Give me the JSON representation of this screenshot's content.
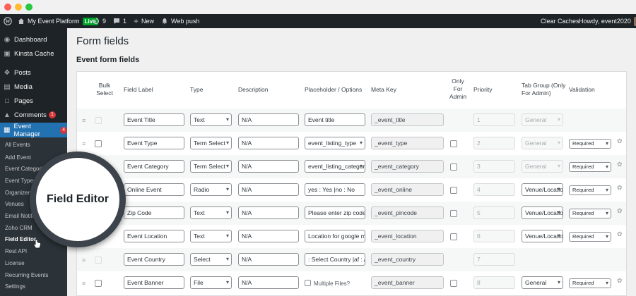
{
  "admin_bar": {
    "site_name": "My Event Platform",
    "live_badge": "Live",
    "updates_count": "9",
    "comments_count": "1",
    "new_label": "New",
    "web_push_label": "Web push",
    "clear_caches_label": "Clear Caches",
    "howdy_label": "Howdy, event2020"
  },
  "sidebar": {
    "items": [
      {
        "label": "Dashboard",
        "icon": "dashboard-icon"
      },
      {
        "label": "Kinsta Cache",
        "icon": "kinsta-icon"
      },
      {
        "label": "Posts",
        "icon": "pin-icon"
      },
      {
        "label": "Media",
        "icon": "media-icon"
      },
      {
        "label": "Pages",
        "icon": "pages-icon"
      },
      {
        "label": "Comments",
        "icon": "comments-icon",
        "badge": "1"
      },
      {
        "label": "Event Manager",
        "icon": "calendar-icon",
        "badge": "4",
        "active": true
      }
    ],
    "submenu": [
      "All Events",
      "Add Event",
      "Event Categories",
      "Event Types",
      "Organizers",
      "Venues",
      "Email Notifications",
      "Zoho CRM",
      "Field Editor",
      "Rest API",
      "License",
      "Recurring Events",
      "Settings"
    ],
    "current_submenu": "Field Editor"
  },
  "magnifier_label": "Field Editor",
  "page_title": "Form fields",
  "section_title": "Event form fields",
  "columns": {
    "bulk_select": "Bulk Select",
    "field_label": "Field Label",
    "type": "Type",
    "description": "Description",
    "placeholder": "Placeholder / Options",
    "meta_key": "Meta Key",
    "only_for_admin": "Only For Admin",
    "priority": "Priority",
    "tab_group": "Tab Group (Only For Admin)",
    "validation": "Validation"
  },
  "rows": [
    {
      "label": "Event Title",
      "type": "Text",
      "description": "N/A",
      "placeholder": "Event title",
      "placeholder_kind": "input",
      "meta_key": "_event_title",
      "priority": "1",
      "tab_group": "General",
      "tab_disabled": true,
      "validation": "",
      "bulk_enabled": false,
      "admin_checkbox": false,
      "gear": false
    },
    {
      "label": "Event Type",
      "type": "Term Select",
      "description": "N/A",
      "placeholder": "event_listing_type",
      "placeholder_kind": "select",
      "meta_key": "_event_type",
      "priority": "2",
      "tab_group": "General",
      "tab_disabled": true,
      "validation": "Required",
      "bulk_enabled": true,
      "admin_checkbox": true,
      "gear": true
    },
    {
      "label": "Event Category",
      "type": "Term Select",
      "description": "N/A",
      "placeholder": "event_listing_category",
      "placeholder_kind": "select",
      "meta_key": "_event_category",
      "priority": "3",
      "tab_group": "General",
      "tab_disabled": true,
      "validation": "Required",
      "bulk_enabled": true,
      "admin_checkbox": true,
      "gear": true
    },
    {
      "label": "Online Event",
      "type": "Radio",
      "description": "N/A",
      "placeholder": "yes : Yes |no : No",
      "placeholder_kind": "input",
      "meta_key": "_event_online",
      "priority": "4",
      "tab_group": "Venue/Location",
      "tab_disabled": false,
      "validation": "Required",
      "bulk_enabled": true,
      "admin_checkbox": true,
      "gear": true
    },
    {
      "label": "Zip Code",
      "type": "Text",
      "description": "N/A",
      "placeholder": "Please enter zip code",
      "placeholder_kind": "input",
      "meta_key": "_event_pincode",
      "priority": "5",
      "tab_group": "Venue/Location",
      "tab_disabled": false,
      "validation": "Required",
      "bulk_enabled": true,
      "admin_checkbox": true,
      "gear": true
    },
    {
      "label": "Event Location",
      "type": "Text",
      "description": "N/A",
      "placeholder": "Location for google maps",
      "placeholder_kind": "input",
      "meta_key": "_event_location",
      "priority": "6",
      "tab_group": "Venue/Location",
      "tab_disabled": false,
      "validation": "Required",
      "bulk_enabled": true,
      "admin_checkbox": true,
      "gear": true
    },
    {
      "label": "Event Country",
      "type": "Select",
      "description": "N/A",
      "placeholder": ": Select Country |af : Afghanistan",
      "placeholder_kind": "input",
      "meta_key": "_event_country",
      "priority": "7",
      "tab_group": "",
      "tab_disabled": false,
      "validation": "",
      "bulk_enabled": false,
      "admin_checkbox": false,
      "gear": false
    },
    {
      "label": "Event Banner",
      "type": "File",
      "description": "N/A",
      "placeholder": "Multiple Files?",
      "placeholder_kind": "checkbox",
      "meta_key": "_event_banner",
      "priority": "8",
      "tab_group": "General",
      "tab_disabled": false,
      "validation": "Required",
      "bulk_enabled": true,
      "admin_checkbox": true,
      "gear": true
    }
  ],
  "colors": {
    "admin_dark": "#1d2327",
    "active_blue": "#2271b1",
    "badge_red": "#d63638",
    "live_green": "#00a32a"
  }
}
